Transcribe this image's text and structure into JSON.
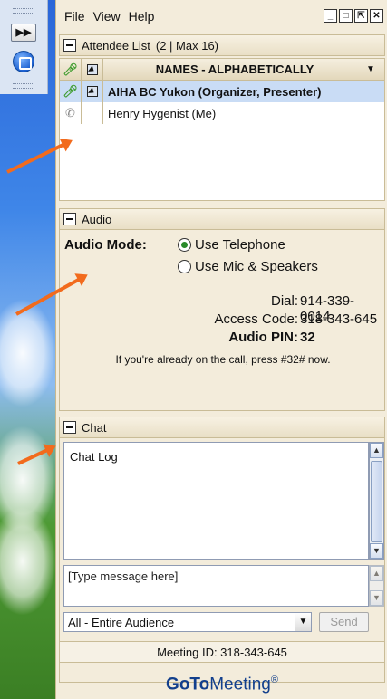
{
  "menu": {
    "items": [
      "File",
      "View",
      "Help"
    ]
  },
  "window_controls": [
    "minimize",
    "restore",
    "detach",
    "close"
  ],
  "attendee": {
    "section_title": "Attendee List",
    "count_text": "(2 | Max 16)",
    "column_header": "NAMES - ALPHABETICALLY",
    "rows": [
      {
        "name": "AIHA BC Yukon (Organizer, Presenter)",
        "audio_icon": "microphone-icon",
        "selected": true
      },
      {
        "name": "Henry Hygenist (Me)",
        "audio_icon": "phone-icon",
        "selected": false
      }
    ]
  },
  "audio": {
    "section_title": "Audio",
    "mode_label": "Audio Mode:",
    "options": [
      {
        "label": "Use Telephone",
        "selected": true
      },
      {
        "label": "Use Mic & Speakers",
        "selected": false
      }
    ],
    "dial_label": "Dial:",
    "dial_value": "914-339-0014",
    "access_label": "Access Code:",
    "access_value": "318-343-645",
    "pin_label": "Audio PIN:",
    "pin_value": "32",
    "note": "If you're already on the call, press #32# now."
  },
  "chat": {
    "section_title": "Chat",
    "log_text": "Chat Log",
    "message_placeholder": "[Type message here]",
    "audience_selected": "All - Entire Audience",
    "send_label": "Send"
  },
  "meeting_id_text": "Meeting ID: 318-343-645",
  "brand": {
    "part1": "GoTo",
    "part2": "Meeting",
    "mark": "®"
  },
  "colors": {
    "panel": "#f3ecdb",
    "arrow": "#f26b1d",
    "selected_row": "#c9dcf5"
  }
}
